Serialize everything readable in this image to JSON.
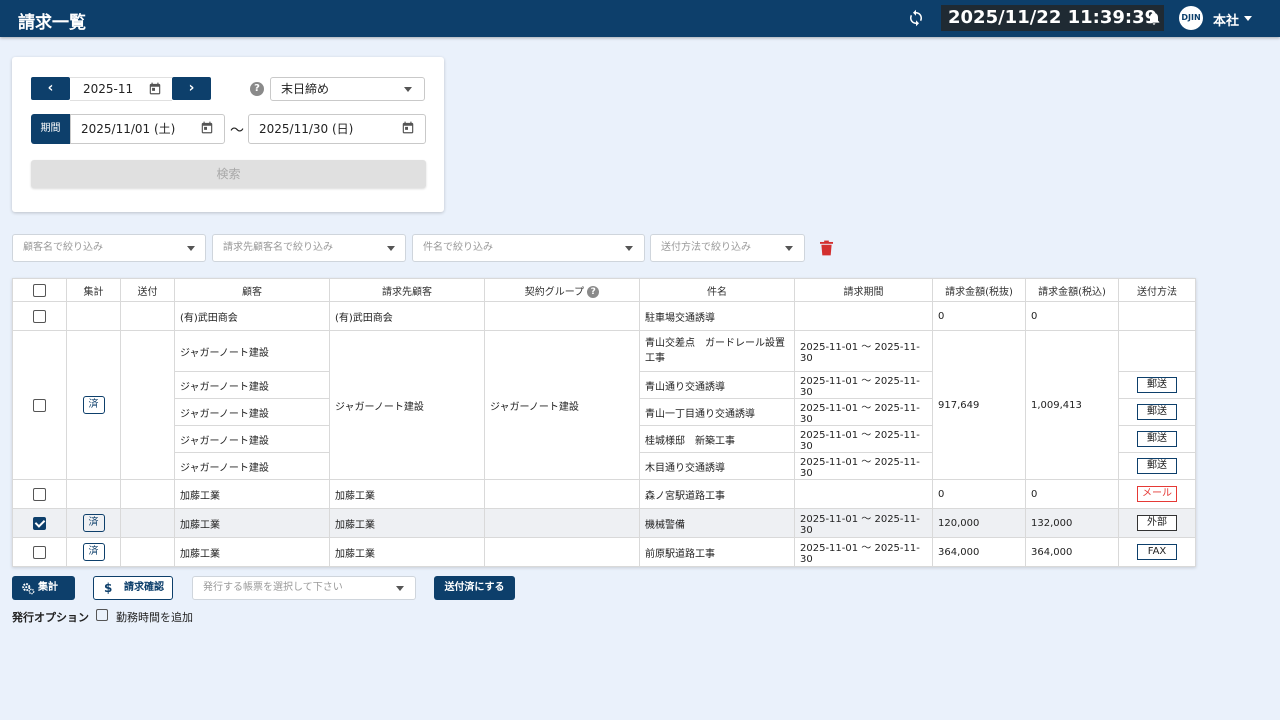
{
  "header": {
    "title": "請求一覧",
    "clock": "2025/11/22 11:39:39",
    "avatar": "DJIN",
    "branch": "本社"
  },
  "search": {
    "month": "2025-11",
    "closing_option": "末日締め",
    "period_label": "期間",
    "date_from": "2025/11/01 (土)",
    "date_to": "2025/11/30 (日)",
    "tilde": "〜",
    "search_button": "検索",
    "help": "?"
  },
  "filters": [
    {
      "placeholder": "顧客名で絞り込み"
    },
    {
      "placeholder": "請求先顧客名で絞り込み"
    },
    {
      "placeholder": "件名で絞り込み"
    },
    {
      "placeholder": "送付方法で絞り込み"
    }
  ],
  "table": {
    "headers": [
      "集計",
      "送付",
      "顧客",
      "請求先顧客",
      "契約グループ",
      "件名",
      "請求期間",
      "請求金額(税抜)",
      "請求金額(税込)",
      "送付方法"
    ],
    "done_label": "済",
    "rows": {
      "r1": {
        "customer": "(有)武田商会",
        "billing": "(有)武田商会",
        "group": "",
        "subject": "駐車場交通誘導",
        "period": "",
        "amount_ex": "0",
        "amount_in": "0",
        "send": ""
      },
      "g": {
        "billing": "ジャガーノート建設",
        "group": "ジャガーノート建設",
        "amount_ex": "917,649",
        "amount_in": "1,009,413",
        "items": [
          {
            "customer": "ジャガーノート建設",
            "subject": "青山交差点　ガードレール設置工事",
            "period": "2025-11-01 ～ 2025-11-30",
            "send": ""
          },
          {
            "customer": "ジャガーノート建設",
            "subject": "青山通り交通誘導",
            "period": "2025-11-01 ～ 2025-11-30",
            "send": "郵送"
          },
          {
            "customer": "ジャガーノート建設",
            "subject": "青山一丁目通り交通誘導",
            "period": "2025-11-01 ～ 2025-11-30",
            "send": "郵送"
          },
          {
            "customer": "ジャガーノート建設",
            "subject": "桂城様邸　新築工事",
            "period": "2025-11-01 ～ 2025-11-30",
            "send": "郵送"
          },
          {
            "customer": "ジャガーノート建設",
            "subject": "木目通り交通誘導",
            "period": "2025-11-01 ～ 2025-11-30",
            "send": "郵送"
          }
        ]
      },
      "r3": {
        "customer": "加藤工業",
        "billing": "加藤工業",
        "group": "",
        "subject": "森ノ宮駅道路工事",
        "period": "",
        "amount_ex": "0",
        "amount_in": "0",
        "send": "メール"
      },
      "r4": {
        "customer": "加藤工業",
        "billing": "加藤工業",
        "group": "",
        "subject": "機械警備",
        "period": "2025-11-01 ～ 2025-11-30",
        "amount_ex": "120,000",
        "amount_in": "132,000",
        "send": "外部"
      },
      "r5": {
        "customer": "加藤工業",
        "billing": "加藤工業",
        "group": "",
        "subject": "前原駅道路工事",
        "period": "2025-11-01 ～ 2025-11-30",
        "amount_ex": "364,000",
        "amount_in": "364,000",
        "send": "FAX"
      }
    }
  },
  "actions": {
    "aggregate": "集計",
    "confirm": "請求確認",
    "doc_select_placeholder": "発行する帳票を選択して下さい",
    "mark_sent": "送付済にする",
    "options_label": "発行オプション",
    "add_work_hours": "勤務時間を追加"
  },
  "colors": {
    "brand": "#0d3f6b",
    "background": "#eaf1fb",
    "mail": "#e53935",
    "trash": "#d32f2f"
  }
}
